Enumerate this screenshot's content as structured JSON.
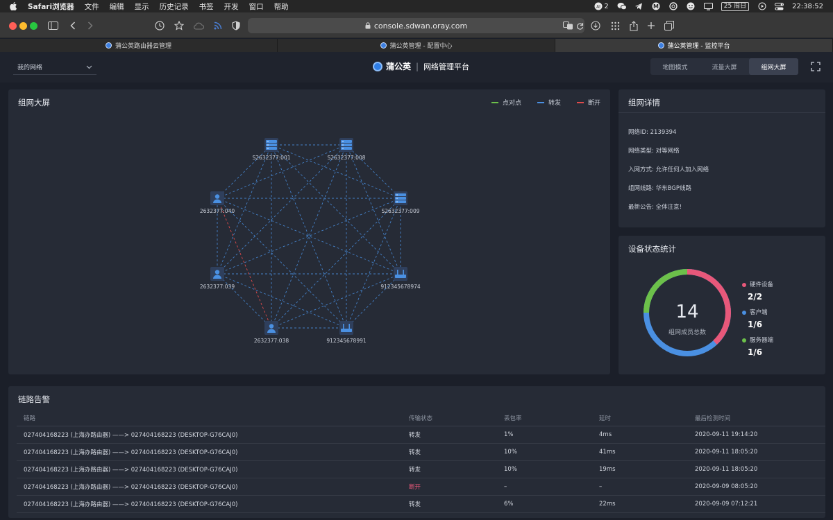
{
  "menubar": {
    "app": "Safari浏览器",
    "items": [
      "文件",
      "编辑",
      "显示",
      "历史记录",
      "书签",
      "开发",
      "窗口",
      "帮助"
    ],
    "badge_count": "2",
    "date_chip": "25 周日",
    "clock": "22:38:52"
  },
  "browser": {
    "url": "console.sdwan.oray.com",
    "tabs": [
      {
        "title": "蒲公英路由器云管理",
        "active": false
      },
      {
        "title": "蒲公英管理 - 配置中心",
        "active": false
      },
      {
        "title": "蒲公英管理 - 监控平台",
        "active": true
      }
    ]
  },
  "header": {
    "network_select": "我的网络",
    "brand": "蒲公英",
    "brand_sub": "网络管理平台",
    "modes": [
      "地图模式",
      "流量大屏",
      "组网大屏"
    ],
    "active_mode": "组网大屏"
  },
  "topology": {
    "title": "组网大屏",
    "legend": [
      {
        "label": "点对点",
        "color": "#6cc04a"
      },
      {
        "label": "转发",
        "color": "#4a90e2"
      },
      {
        "label": "断开",
        "color": "#e04b4b"
      }
    ],
    "nodes": [
      {
        "id": "S2632377:001",
        "label": "S2632377:001",
        "icon": "server-icon"
      },
      {
        "id": "S2632377:008",
        "label": "S2632377:008",
        "icon": "server-icon"
      },
      {
        "id": "S2632377:009",
        "label": "S2632377:009",
        "icon": "server-icon"
      },
      {
        "id": "912345678974",
        "label": "912345678974",
        "icon": "router-icon"
      },
      {
        "id": "912345678991",
        "label": "912345678991",
        "icon": "router-icon"
      },
      {
        "id": "2632377:038",
        "label": "2632377:038",
        "icon": "user-icon"
      },
      {
        "id": "2632377:039",
        "label": "2632377:039",
        "icon": "user-icon"
      },
      {
        "id": "2632377:040",
        "label": "2632377:040",
        "icon": "user-icon"
      }
    ],
    "broken_link": [
      "2632377:040",
      "2632377:038"
    ]
  },
  "details": {
    "title": "组网详情",
    "rows": [
      {
        "label": "网络ID",
        "value": "2139394"
      },
      {
        "label": "网络类型",
        "value": "对等网络"
      },
      {
        "label": "入网方式",
        "value": "允许任何人加入网络"
      },
      {
        "label": "组网线路",
        "value": "华东BGP线路"
      },
      {
        "label": "最新公告",
        "value": "全体注意!"
      }
    ]
  },
  "device_stats": {
    "title": "设备状态统计",
    "total": "14",
    "total_label": "组网成员总数",
    "items": [
      {
        "label": "硬件设备",
        "value": "2/2",
        "color": "#e8587a"
      },
      {
        "label": "客户端",
        "value": "1/6",
        "color": "#4a90e2"
      },
      {
        "label": "服务器端",
        "value": "1/6",
        "color": "#6cc04a"
      }
    ]
  },
  "alerts": {
    "title": "链路告警",
    "columns": [
      "链路",
      "传输状态",
      "丢包率",
      "延时",
      "最后检测时间"
    ],
    "rows": [
      [
        "027404168223 (上海办路由器) ——> 027404168223 (DESKTOP-G76CAJ0)",
        "转发",
        "1%",
        "4ms",
        "2020-09-11 19:14:20"
      ],
      [
        "027404168223 (上海办路由器) ——> 027404168223 (DESKTOP-G76CAJ0)",
        "转发",
        "10%",
        "41ms",
        "2020-09-11 18:05:20"
      ],
      [
        "027404168223 (上海办路由器) ——> 027404168223 (DESKTOP-G76CAJ0)",
        "转发",
        "10%",
        "19ms",
        "2020-09-11 18:05:20"
      ],
      [
        "027404168223 (上海办路由器) ——> 027404168223 (DESKTOP-G76CAJ0)",
        "断开",
        "–",
        "–",
        "2020-09-09 08:05:20"
      ],
      [
        "027404168223 (上海办路由器) ——> 027404168223 (DESKTOP-G76CAJ0)",
        "转发",
        "6%",
        "22ms",
        "2020-09-09 07:12:21"
      ]
    ]
  }
}
